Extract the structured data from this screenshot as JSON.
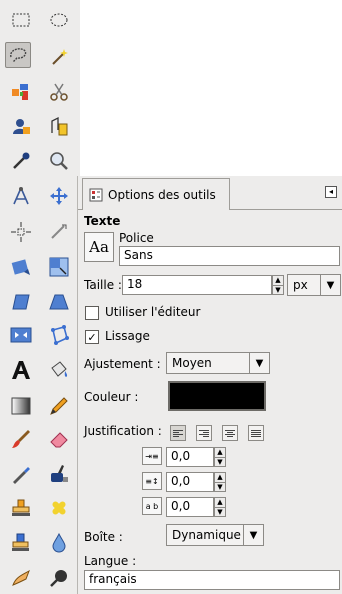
{
  "toolbox": {
    "tools": [
      {
        "name": "rect-select-tool",
        "icon": "rectangle-select-icon"
      },
      {
        "name": "ellipse-select-tool",
        "icon": "ellipse-select-icon"
      },
      {
        "name": "free-select-tool",
        "icon": "lasso-icon",
        "active": true
      },
      {
        "name": "fuzzy-select-tool",
        "icon": "magic-wand-icon"
      },
      {
        "name": "select-by-color-tool",
        "icon": "color-select-icon"
      },
      {
        "name": "scissors-select-tool",
        "icon": "scissors-icon"
      },
      {
        "name": "foreground-select-tool",
        "icon": "foreground-select-icon"
      },
      {
        "name": "paths-tool",
        "icon": "paths-icon"
      },
      {
        "name": "color-picker-tool",
        "icon": "eyedropper-icon"
      },
      {
        "name": "zoom-tool",
        "icon": "magnifier-icon"
      },
      {
        "name": "measure-tool",
        "icon": "compass-icon"
      },
      {
        "name": "move-tool",
        "icon": "move-icon"
      },
      {
        "name": "align-tool",
        "icon": "align-icon"
      },
      {
        "name": "crop-tool",
        "icon": "crop-icon"
      },
      {
        "name": "rotate-tool",
        "icon": "rotate-icon"
      },
      {
        "name": "scale-tool",
        "icon": "scale-icon"
      },
      {
        "name": "shear-tool",
        "icon": "shear-icon"
      },
      {
        "name": "perspective-tool",
        "icon": "perspective-icon"
      },
      {
        "name": "flip-tool",
        "icon": "flip-icon"
      },
      {
        "name": "cage-tool",
        "icon": "cage-icon"
      },
      {
        "name": "text-tool",
        "icon": "text-icon"
      },
      {
        "name": "bucket-fill-tool",
        "icon": "bucket-icon"
      },
      {
        "name": "blend-tool",
        "icon": "gradient-icon"
      },
      {
        "name": "pencil-tool",
        "icon": "pencil-icon"
      },
      {
        "name": "paintbrush-tool",
        "icon": "brush-icon"
      },
      {
        "name": "eraser-tool",
        "icon": "eraser-icon"
      },
      {
        "name": "airbrush-tool",
        "icon": "airbrush-icon"
      },
      {
        "name": "ink-tool",
        "icon": "ink-icon"
      },
      {
        "name": "clone-tool",
        "icon": "stamp-icon"
      },
      {
        "name": "heal-tool",
        "icon": "heal-icon"
      },
      {
        "name": "perspective-clone-tool",
        "icon": "perspective-clone-icon"
      },
      {
        "name": "blur-sharpen-tool",
        "icon": "drop-icon"
      },
      {
        "name": "smudge-tool",
        "icon": "smudge-icon"
      },
      {
        "name": "dodge-burn-tool",
        "icon": "dodge-burn-icon"
      }
    ]
  },
  "panel": {
    "tab_label": "Options des outils",
    "tab_icon": "tool-options-icon",
    "menu_icon": "tab-menu-icon",
    "section_title": "Texte",
    "font": {
      "label": "Police",
      "preview": "Aa",
      "value": "Sans"
    },
    "size": {
      "label": "Taille :",
      "value": "18",
      "unit": "px"
    },
    "use_editor": {
      "label": "Utiliser l'éditeur",
      "checked": false
    },
    "antialias": {
      "label": "Lissage",
      "checked": true
    },
    "hinting": {
      "label": "Ajustement :",
      "value": "Moyen"
    },
    "color": {
      "label": "Couleur :",
      "value": "#000000"
    },
    "justify": {
      "label": "Justification :",
      "options": [
        "left",
        "right",
        "center",
        "fill"
      ],
      "selected": "left"
    },
    "indent": {
      "value": "0,0"
    },
    "line_spacing": {
      "value": "0,0"
    },
    "letter_spacing": {
      "value": "0,0"
    },
    "box": {
      "label": "Boîte :",
      "value": "Dynamique"
    },
    "language": {
      "label": "Langue :",
      "value": "français"
    }
  }
}
